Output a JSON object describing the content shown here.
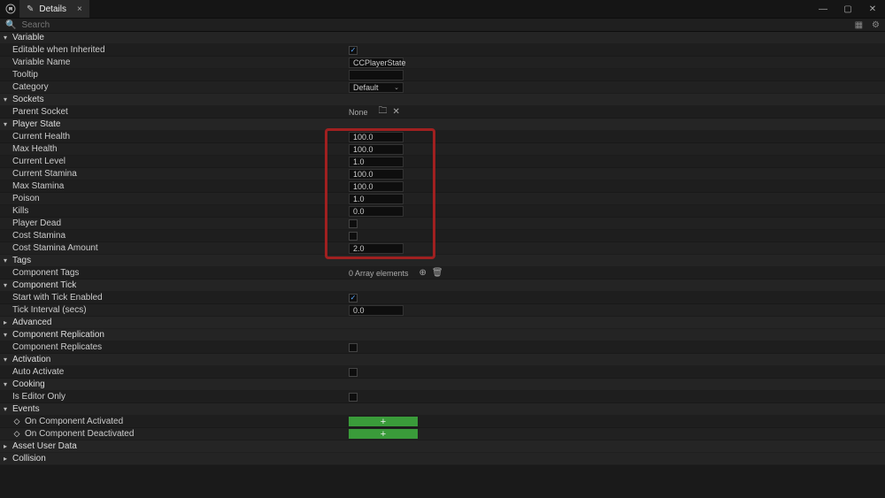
{
  "titlebar": {
    "tab_label": "Details"
  },
  "search": {
    "placeholder": "Search"
  },
  "sections": {
    "variable": {
      "title": "Variable",
      "editable_when_inherited": {
        "label": "Editable when Inherited",
        "checked": true
      },
      "variable_name": {
        "label": "Variable Name",
        "value": "CCPlayerState"
      },
      "tooltip": {
        "label": "Tooltip",
        "value": ""
      },
      "category": {
        "label": "Category",
        "value": "Default"
      }
    },
    "sockets": {
      "title": "Sockets",
      "parent_socket": {
        "label": "Parent Socket",
        "value": "None"
      }
    },
    "player_state": {
      "title": "Player State",
      "current_health": {
        "label": "Current Health",
        "value": "100.0"
      },
      "max_health": {
        "label": "Max Health",
        "value": "100.0"
      },
      "current_level": {
        "label": "Current Level",
        "value": "1.0"
      },
      "current_stamina": {
        "label": "Current Stamina",
        "value": "100.0"
      },
      "max_stamina": {
        "label": "Max Stamina",
        "value": "100.0"
      },
      "poison": {
        "label": "Poison",
        "value": "1.0"
      },
      "kills": {
        "label": "Kills",
        "value": "0.0"
      },
      "player_dead": {
        "label": "Player Dead",
        "checked": false
      },
      "cost_stamina": {
        "label": "Cost Stamina",
        "checked": false
      },
      "cost_stamina_amount": {
        "label": "Cost Stamina Amount",
        "value": "2.0"
      }
    },
    "tags": {
      "title": "Tags",
      "component_tags": {
        "label": "Component Tags",
        "value": "0 Array elements"
      }
    },
    "component_tick": {
      "title": "Component Tick",
      "start_enabled": {
        "label": "Start with Tick Enabled",
        "checked": true
      },
      "tick_interval": {
        "label": "Tick Interval (secs)",
        "value": "0.0"
      }
    },
    "advanced": {
      "title": "Advanced"
    },
    "component_replication": {
      "title": "Component Replication",
      "replicates": {
        "label": "Component Replicates",
        "checked": false
      }
    },
    "activation": {
      "title": "Activation",
      "auto_activate": {
        "label": "Auto Activate",
        "checked": false
      }
    },
    "cooking": {
      "title": "Cooking",
      "editor_only": {
        "label": "Is Editor Only",
        "checked": false
      }
    },
    "events": {
      "title": "Events",
      "on_activated": {
        "label": "On Component Activated"
      },
      "on_deactivated": {
        "label": "On Component Deactivated"
      }
    },
    "asset_user_data": {
      "title": "Asset User Data"
    },
    "collision": {
      "title": "Collision"
    }
  }
}
